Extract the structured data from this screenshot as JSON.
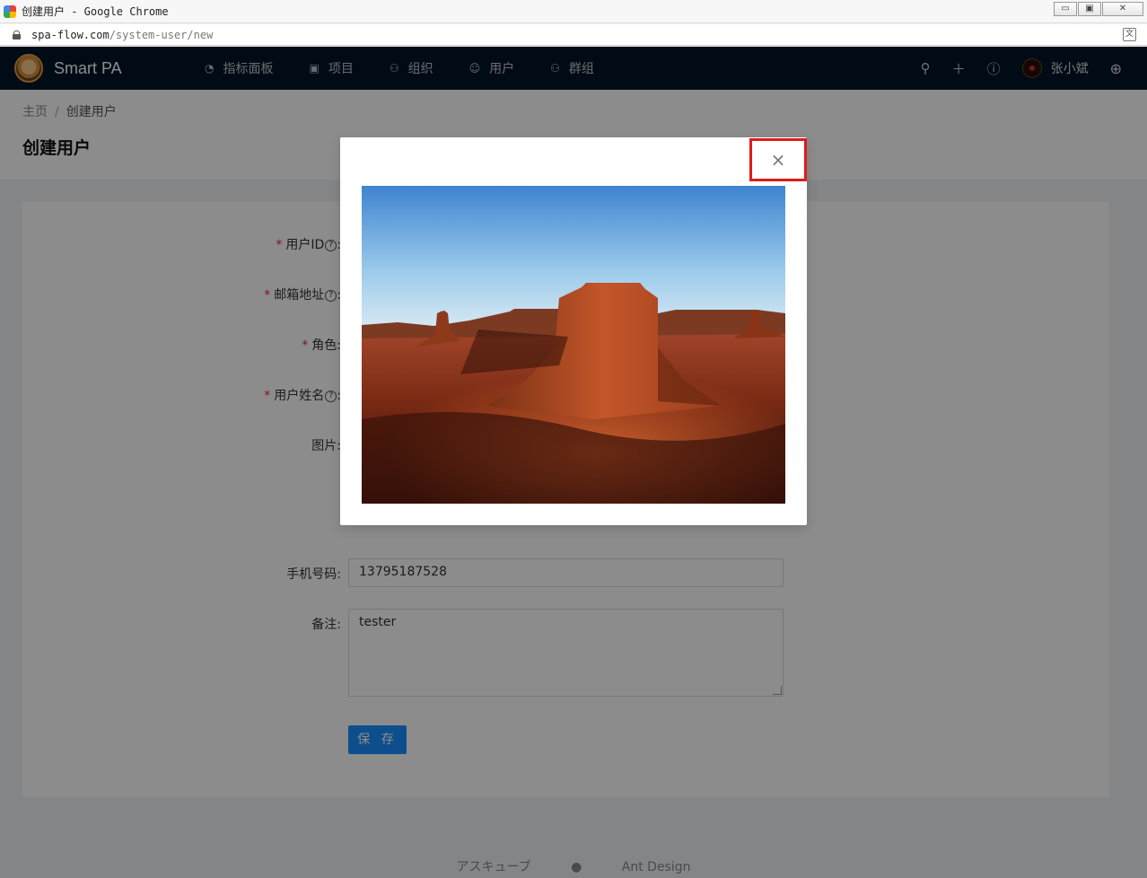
{
  "window": {
    "title": "创建用户 - Google Chrome",
    "url_host": "spa-flow.com",
    "url_path": "/system-user/new",
    "controls": [
      "▭",
      "▣",
      "✕"
    ]
  },
  "header": {
    "brand": "Smart PA",
    "nav": [
      {
        "label": "指标面板",
        "icon": "dashboard-icon"
      },
      {
        "label": "项目",
        "icon": "project-icon"
      },
      {
        "label": "组织",
        "icon": "organization-icon"
      },
      {
        "label": "用户",
        "icon": "user-icon"
      },
      {
        "label": "群组",
        "icon": "group-icon"
      }
    ],
    "username": "张小斌"
  },
  "page": {
    "breadcrumb_home": "主页",
    "breadcrumb_sep": "/",
    "breadcrumb_current": "创建用户",
    "title": "创建用户"
  },
  "form": {
    "user_id_label": "用户ID",
    "email_label": "邮箱地址",
    "role_label": "角色",
    "name_label": "用户姓名",
    "picture_label": "图片",
    "phone_label": "手机号码",
    "phone_value": "13795187528",
    "note_label": "备注",
    "note_value": "tester",
    "save_label": "保 存",
    "colon": ":",
    "required_mark": "*",
    "help_mark": "?"
  },
  "footer": {
    "links": [
      "アスキューブ",
      "Ant Design"
    ]
  },
  "modal": {
    "close_glyph": "×"
  },
  "colors": {
    "header_bg": "#001529",
    "primary": "#1890ff",
    "close_highlight": "#e01a1a"
  }
}
